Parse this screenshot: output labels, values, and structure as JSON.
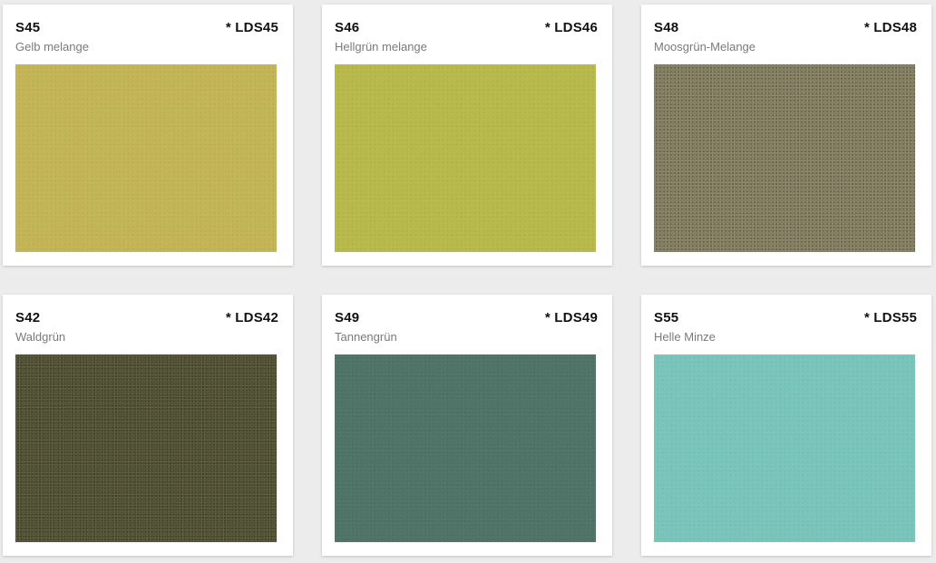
{
  "swatches": [
    {
      "code": "S45",
      "ref": "* LDS45",
      "name": "Gelb melange",
      "color": "#c3b456",
      "texture": "flat"
    },
    {
      "code": "S46",
      "ref": "* LDS46",
      "name": "Hellgrün melange",
      "color": "#b7b94a",
      "texture": "flat"
    },
    {
      "code": "S48",
      "ref": "* LDS48",
      "name": "Moosgrün-Melange",
      "color": "#807a5c",
      "texture": "heather"
    },
    {
      "code": "S42",
      "ref": "* LDS42",
      "name": "Waldgrün",
      "color": "#4b4a2c",
      "texture": "heather"
    },
    {
      "code": "S49",
      "ref": "* LDS49",
      "name": "Tannengrün",
      "color": "#4e7367",
      "texture": "flat"
    },
    {
      "code": "S55",
      "ref": "* LDS55",
      "name": "Helle Minze",
      "color": "#79c4bb",
      "texture": "flat"
    }
  ]
}
